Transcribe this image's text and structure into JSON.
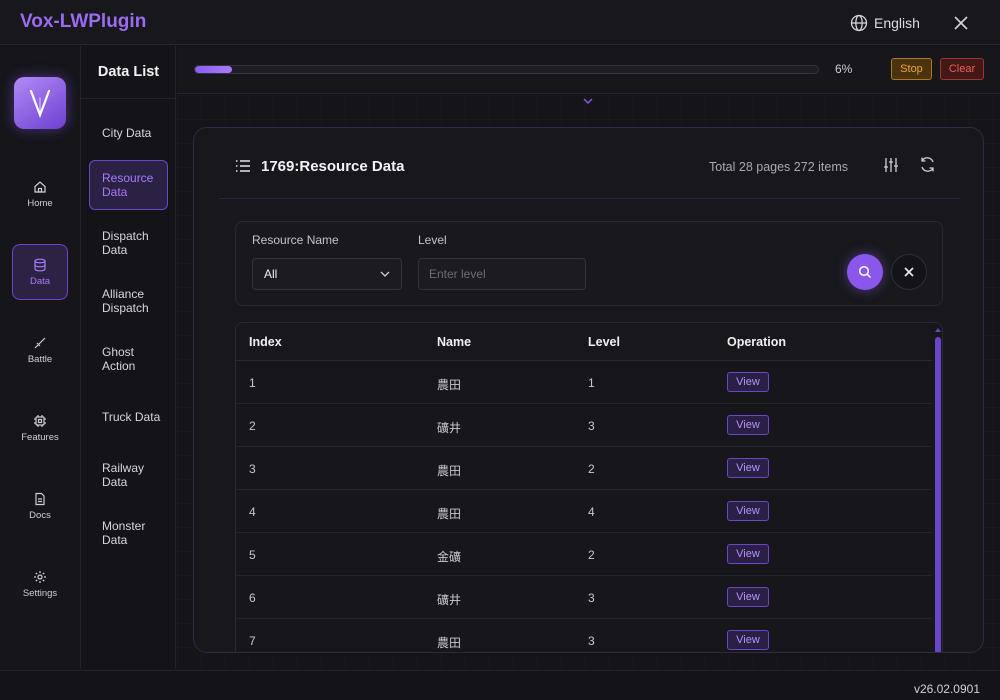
{
  "app": {
    "title": "Vox-LWPlugin",
    "version": "v26.02.0901"
  },
  "titlebar": {
    "language": "English"
  },
  "logo": {
    "letter": "V"
  },
  "nav": [
    {
      "label": "Home",
      "icon": "home-icon",
      "active": false
    },
    {
      "label": "Data",
      "icon": "database-icon",
      "active": true
    },
    {
      "label": "Battle",
      "icon": "sword-icon",
      "active": false
    },
    {
      "label": "Features",
      "icon": "chip-icon",
      "active": false
    },
    {
      "label": "Docs",
      "icon": "document-icon",
      "active": false
    },
    {
      "label": "Settings",
      "icon": "gear-icon",
      "active": false
    }
  ],
  "data_list": {
    "title": "Data List",
    "items": [
      {
        "label": "City Data",
        "active": false
      },
      {
        "label": "Resource Data",
        "active": true
      },
      {
        "label": "Dispatch Data",
        "active": false
      },
      {
        "label": "Alliance Dispatch",
        "active": false
      },
      {
        "label": "Ghost Action",
        "active": false
      },
      {
        "label": "Truck Data",
        "active": false
      },
      {
        "label": "Railway Data",
        "active": false
      },
      {
        "label": "Monster Data",
        "active": false
      }
    ]
  },
  "progress": {
    "value": 0.06,
    "label": "6%",
    "stop_label": "Stop",
    "clear_label": "Clear"
  },
  "card": {
    "title": "1769:Resource Data",
    "total_text": "Total 28 pages 272 items"
  },
  "search": {
    "resource_name_label": "Resource Name",
    "resource_name_value": "All",
    "level_label": "Level",
    "level_placeholder": "Enter level"
  },
  "table": {
    "columns": [
      "Index",
      "Name",
      "Level",
      "Operation"
    ],
    "view_label": "View",
    "rows": [
      {
        "index": "1",
        "name": "農田",
        "level": "1"
      },
      {
        "index": "2",
        "name": "礦井",
        "level": "3"
      },
      {
        "index": "3",
        "name": "農田",
        "level": "2"
      },
      {
        "index": "4",
        "name": "農田",
        "level": "4"
      },
      {
        "index": "5",
        "name": "金礦",
        "level": "2"
      },
      {
        "index": "6",
        "name": "礦井",
        "level": "3"
      },
      {
        "index": "7",
        "name": "農田",
        "level": "3"
      }
    ]
  },
  "colors": {
    "accent": "#8a56ec",
    "accent_text": "#a77cf6",
    "stop": "#f0a43a",
    "clear": "#ee5b5b"
  }
}
